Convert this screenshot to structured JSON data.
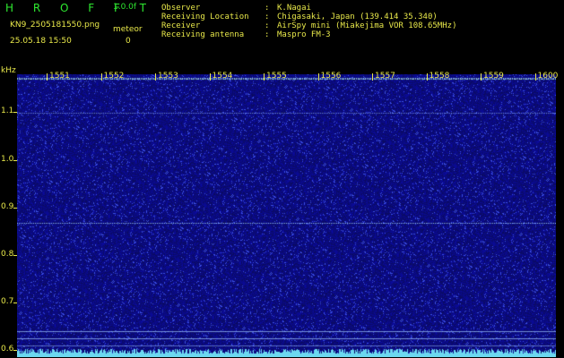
{
  "header": {
    "app_title": "H R O F F T",
    "version": "1.0.0f",
    "filename": "KN9_2505181550.png",
    "datetime": "25.05.18 15:50",
    "meteor_label": "meteor",
    "meteor_value": "0",
    "info": [
      {
        "key": "Observer",
        "value": "K.Nagai"
      },
      {
        "key": "Receiving Location",
        "value": "Chigasaki, Japan (139.414 35.340)"
      },
      {
        "key": "Receiver",
        "value": "AirSpy mini (Miakejima VOR 108.65MHz)"
      },
      {
        "key": "Receiving antenna",
        "value": "Maspro FM-3"
      }
    ]
  },
  "chart_data": {
    "type": "heatmap",
    "y_unit": "kHz",
    "y_ticks": [
      "1.1",
      "1.0",
      "0.9",
      "0.8",
      "0.7",
      "0.6"
    ],
    "x_ticks": [
      "1551",
      "1552",
      "1553",
      "1554",
      "1555",
      "1556",
      "1557",
      "1558",
      "1559",
      "1600"
    ],
    "ylim": [
      0.585,
      1.18
    ],
    "colors": {
      "background": "#10108a",
      "noise": "#3a4ad8",
      "signal": "#a8f0ff",
      "label": "#e8e84a",
      "title": "#2ee830"
    }
  }
}
